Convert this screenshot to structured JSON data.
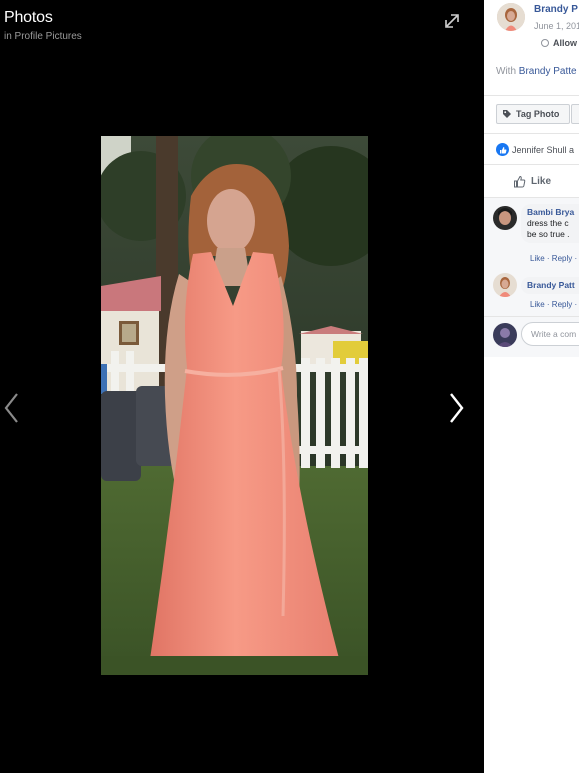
{
  "viewer": {
    "title": "Photos",
    "subtitle": "in Profile Pictures"
  },
  "icons": {
    "expand": "expand-icon",
    "prev": "chevron-left-icon",
    "next": "chevron-right-icon",
    "tag": "tag-icon",
    "like": "thumbs-up-icon",
    "globe": "radio-icon"
  },
  "panel": {
    "author_name": "Brandy P",
    "date": "June 1, 201",
    "allow_label": "Allow",
    "with_prefix": "With",
    "with_name": "Brandy Patte",
    "tag_photo_label": "Tag Photo",
    "reactions_text": "Jennifer Shull a",
    "like_label": "Like"
  },
  "comments": [
    {
      "name": "Bambi Brya",
      "text_line1": "dress the c",
      "text_line2": "be so true .",
      "actions": "Like · Reply ·"
    },
    {
      "name": "Brandy Patt",
      "actions": "Like · Reply ·"
    }
  ],
  "composer": {
    "placeholder": "Write a com"
  },
  "colors": {
    "link": "#385898",
    "accent": "#1877f2",
    "dress": "#f08a7a"
  }
}
